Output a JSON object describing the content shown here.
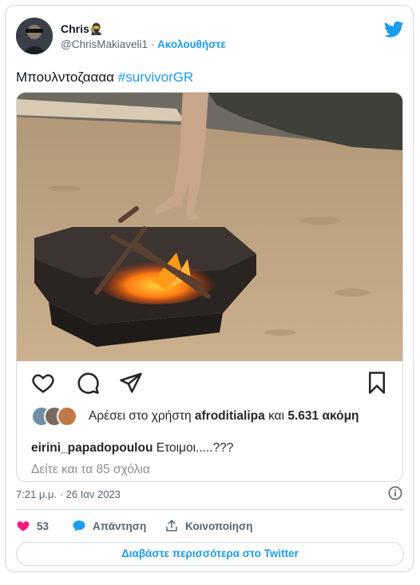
{
  "tweet": {
    "author_name": "Chris🥷",
    "author_handle": "@ChrisMakiaveli1",
    "separator": "·",
    "follow_label": "Ακολουθήστε",
    "text": "Μπουλντοζαααα",
    "hashtag": "#survivorGR",
    "timestamp": "7:21 μ.μ. · 26 Ιαν 2023"
  },
  "instagram_embed": {
    "likes_prefix": "Αρέσει στο χρήστη",
    "likes_user": "afroditialipa",
    "likes_conj": "και",
    "likes_count": "5.631 ακόμη",
    "comment_user": "eirini_papadopoulou",
    "comment_text": "Ετοιμοι.....???",
    "view_comments": "Δείτε και τα 85 σχόλια"
  },
  "actions": {
    "like_count": "53",
    "reply_label": "Απάντηση",
    "share_label": "Κοινοποίηση",
    "read_more_label": "Διαβάστε περισσότερα στο Twitter"
  },
  "icons": {
    "twitter": "twitter-bird-icon",
    "heart": "heart-icon",
    "reply": "speech-bubble-icon",
    "share": "share-arrow-icon",
    "info": "info-icon",
    "ig_like": "heart-outline-icon",
    "ig_comment": "comment-icon",
    "ig_share": "paper-plane-icon",
    "ig_save": "bookmark-icon"
  },
  "colors": {
    "accent": "#1d9bf0",
    "like": "#f91880",
    "muted": "#536471",
    "border": "#cfd9de"
  }
}
